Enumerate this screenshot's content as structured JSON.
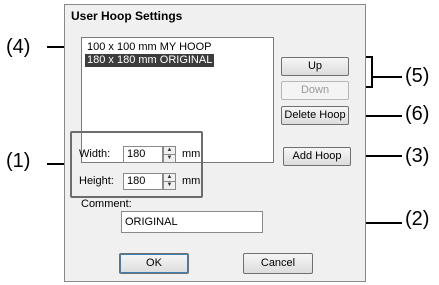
{
  "dialog": {
    "title": "User Hoop Settings"
  },
  "hoop_list": {
    "items": [
      {
        "label": "100 x 100 mm MY HOOP",
        "selected": false
      },
      {
        "label": "180 x 180 mm ORIGINAL",
        "selected": true
      }
    ]
  },
  "buttons": {
    "up": "Up",
    "down": "Down",
    "delete_hoop": "Delete Hoop",
    "add_hoop": "Add Hoop",
    "ok": "OK",
    "cancel": "Cancel"
  },
  "size": {
    "width_label": "Width:",
    "width_value": "180",
    "width_unit": "mm",
    "height_label": "Height:",
    "height_value": "180",
    "height_unit": "mm"
  },
  "comment": {
    "label": "Comment:",
    "value": "ORIGINAL"
  },
  "callouts": {
    "c1": "(1)",
    "c2": "(2)",
    "c3": "(3)",
    "c4": "(4)",
    "c5": "(5)",
    "c6": "(6)"
  },
  "colors": {
    "selection": "#3c3c3c",
    "dialog_bg": "#f0f0f0"
  }
}
